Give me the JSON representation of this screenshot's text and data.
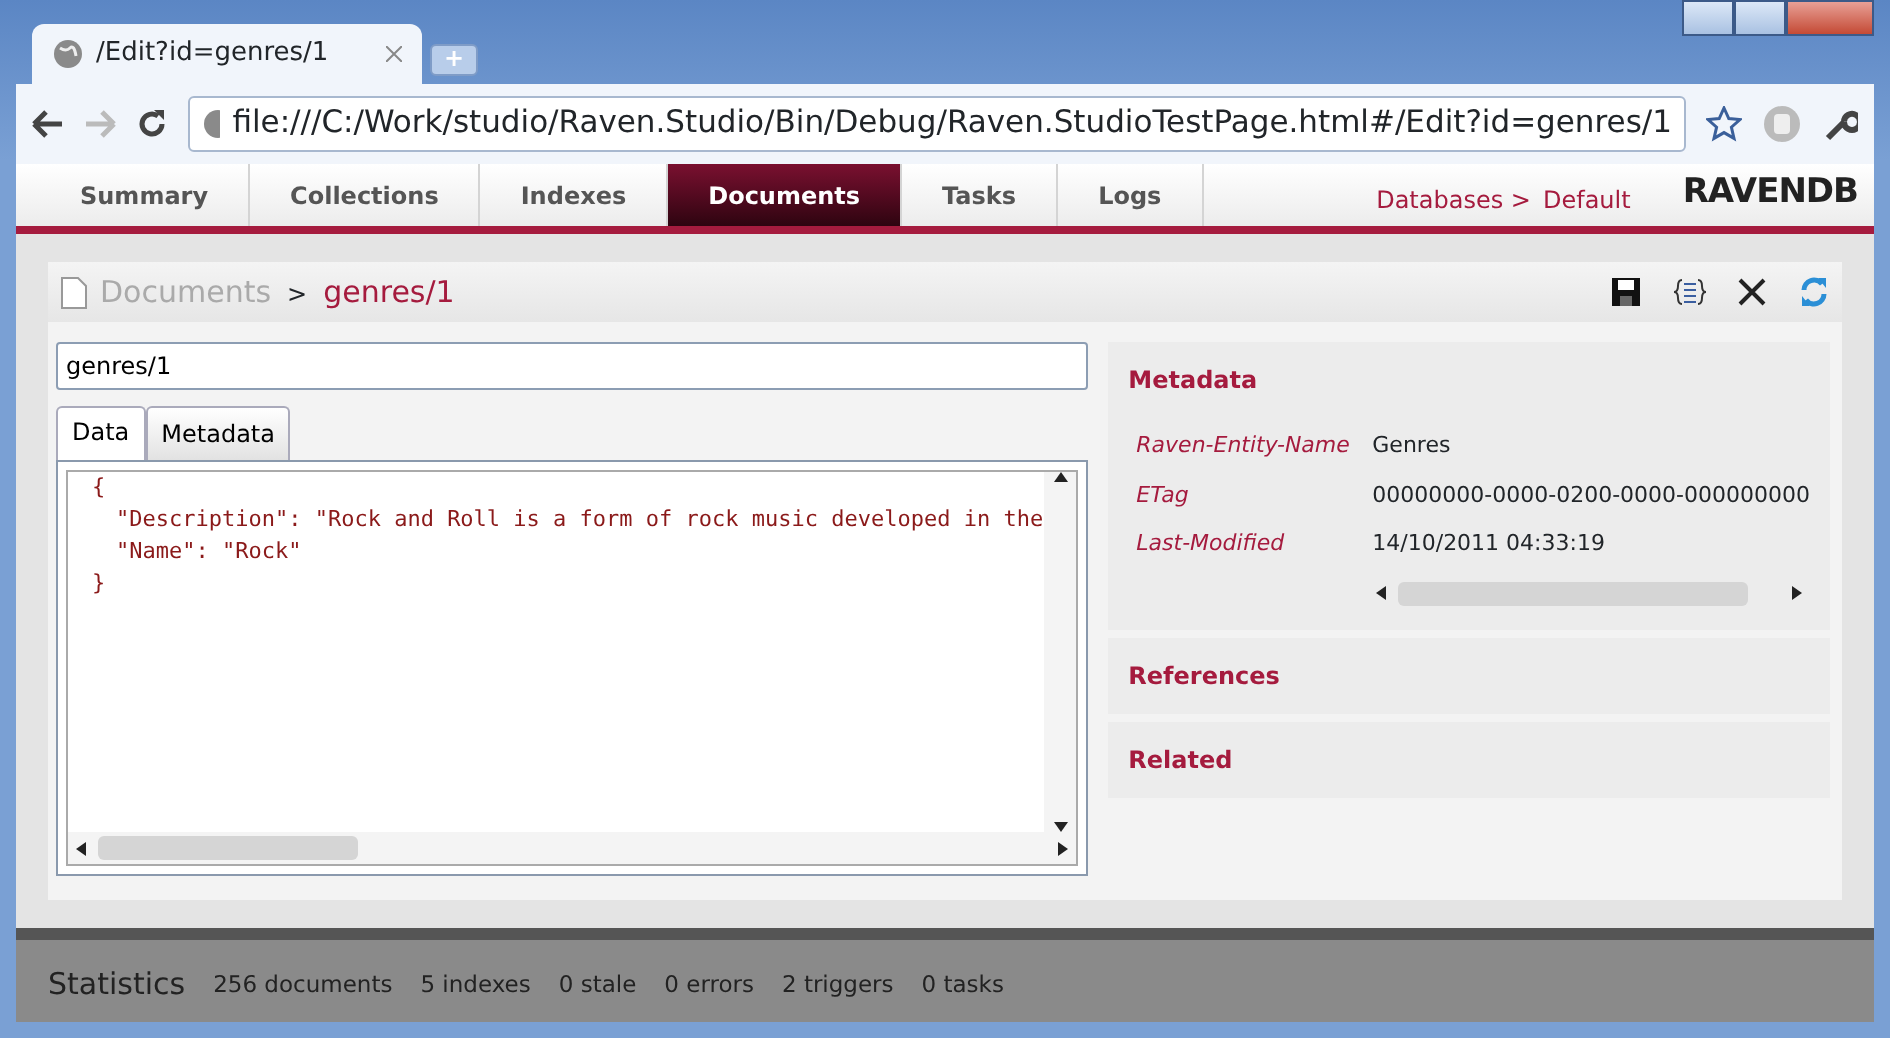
{
  "browser": {
    "tab_title": "/Edit?id=genres/1",
    "new_tab": "+",
    "address": "file:///C:/Work/studio/Raven.Studio/Bin/Debug/Raven.StudioTestPage.html#/Edit?id=genres/1"
  },
  "nav": {
    "tabs": [
      {
        "label": "Summary",
        "selected": false
      },
      {
        "label": "Collections",
        "selected": false
      },
      {
        "label": "Indexes",
        "selected": false
      },
      {
        "label": "Documents",
        "selected": true
      },
      {
        "label": "Tasks",
        "selected": false
      },
      {
        "label": "Logs",
        "selected": false
      }
    ],
    "databases_label": "Databases >",
    "database": "Default",
    "logo": "RAVENDB"
  },
  "breadcrumb": {
    "parent": "Documents",
    "separator": ">",
    "current": "genres/1"
  },
  "document": {
    "id": "genres/1",
    "tabs": [
      {
        "label": "Data",
        "selected": true
      },
      {
        "label": "Metadata",
        "selected": false
      }
    ],
    "json_lines": [
      {
        "text": "{",
        "kind": "brace"
      },
      {
        "text": "\"Description\": \"Rock and Roll is a form of rock music developed in the",
        "kind": "pair"
      },
      {
        "text": "\"Name\": \"Rock\"",
        "kind": "pair"
      },
      {
        "text": "}",
        "kind": "brace"
      }
    ]
  },
  "metadata": {
    "title": "Metadata",
    "rows": [
      {
        "key": "Raven-Entity-Name",
        "value": "Genres"
      },
      {
        "key": "ETag",
        "value": "00000000-0000-0200-0000-000000000"
      },
      {
        "key": "Last-Modified",
        "value": "14/10/2011 04:33:19"
      }
    ]
  },
  "sections": [
    "References",
    "Related"
  ],
  "statistics": {
    "title": "Statistics",
    "items": [
      "256 documents",
      "5 indexes",
      "0 stale",
      "0 errors",
      "2 triggers",
      "0 tasks"
    ]
  }
}
